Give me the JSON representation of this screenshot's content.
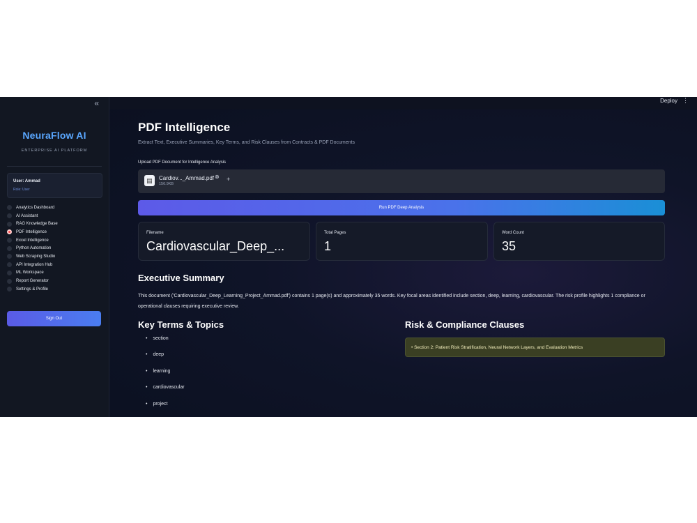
{
  "sidebar": {
    "collapse_icon": "«",
    "brand": "NeuraFlow AI",
    "tagline": "ENTERPRISE AI PLATFORM",
    "user_name": "User: Ammad",
    "user_role": "Role: User",
    "nav": [
      {
        "label": "Analytics Dashboard",
        "selected": false
      },
      {
        "label": "AI Assistant",
        "selected": false
      },
      {
        "label": "RAG Knowledge Base",
        "selected": false
      },
      {
        "label": "PDF Intelligence",
        "selected": true
      },
      {
        "label": "Excel Intelligence",
        "selected": false
      },
      {
        "label": "Python Automation",
        "selected": false
      },
      {
        "label": "Web Scraping Studio",
        "selected": false
      },
      {
        "label": "API Integration Hub",
        "selected": false
      },
      {
        "label": "ML Workspace",
        "selected": false
      },
      {
        "label": "Report Generator",
        "selected": false
      },
      {
        "label": "Settings & Profile",
        "selected": false
      }
    ],
    "sign_out": "Sign Out"
  },
  "topbar": {
    "deploy": "Deploy",
    "menu_icon": "⋮"
  },
  "page": {
    "title": "PDF Intelligence",
    "subtitle": "Extract Text, Executive Summaries, Key Terms, and Risk Clauses from Contracts & PDF Documents"
  },
  "upload": {
    "label": "Upload PDF Document for Intelligence Analysis",
    "file_name": "Cardiov..._Ammad.pdf",
    "file_size": "156.9KB",
    "file_icon": "▤",
    "remove_icon": "⊗",
    "add_icon": "+"
  },
  "run_button": "Run PDF Deep Analysis",
  "metrics": [
    {
      "label": "Filename",
      "value": "Cardiovascular_Deep_..."
    },
    {
      "label": "Total Pages",
      "value": "1"
    },
    {
      "label": "Word Count",
      "value": "35"
    }
  ],
  "summary": {
    "heading": "Executive Summary",
    "text": "This document ('Cardiovascular_Deep_Learning_Project_Ammad.pdf') contains 1 page(s) and approximately 35 words. Key focal areas identified include section, deep, learning, cardiovascular. The risk profile highlights 1 compliance or operational clauses requiring executive review."
  },
  "key_terms": {
    "heading": "Key Terms & Topics",
    "items": [
      "section",
      "deep",
      "learning",
      "cardiovascular",
      "project"
    ]
  },
  "risk": {
    "heading": "Risk & Compliance Clauses",
    "items": [
      "• Section 2: Patient Risk Stratification, Neural Network Layers, and Evaluation Metrics"
    ]
  },
  "colors": {
    "brand": "#5aa7ff",
    "accent": "#5d5ae8",
    "selected_radio": "#ff4b4b",
    "risk_bg": "#3a3f23"
  }
}
